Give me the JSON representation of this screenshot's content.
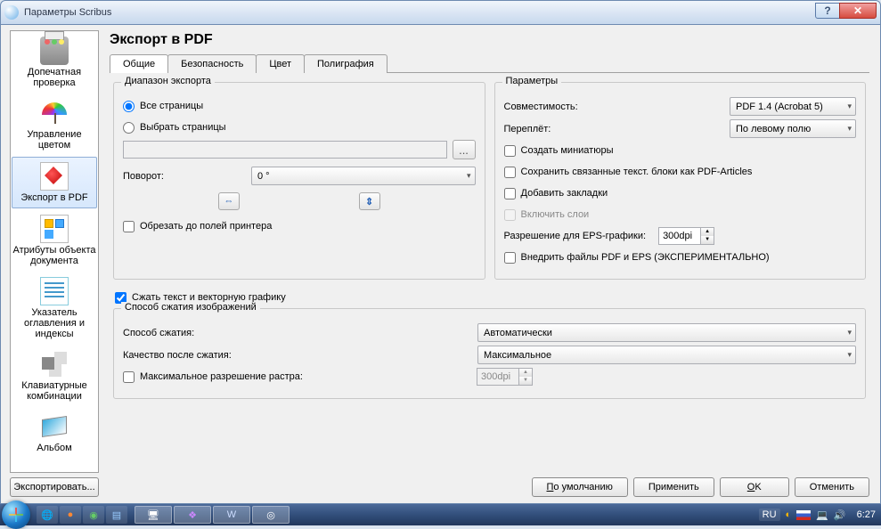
{
  "window": {
    "title": "Параметры Scribus",
    "help": "?",
    "close": "✕"
  },
  "sidebar": {
    "items": [
      {
        "label": "Допечатная проверка"
      },
      {
        "label": "Управление цветом"
      },
      {
        "label": "Экспорт в PDF"
      },
      {
        "label": "Атрибуты объекта документа"
      },
      {
        "label": "Указатель оглавления и индексы"
      },
      {
        "label": "Клавиатурные комбинации"
      },
      {
        "label": "Альбом"
      }
    ],
    "export_btn": "Экспортировать..."
  },
  "main": {
    "heading": "Экспорт в PDF",
    "tabs": [
      "Общие",
      "Безопасность",
      "Цвет",
      "Полиграфия"
    ],
    "range": {
      "legend": "Диапазон экспорта",
      "all_pages": "Все страницы",
      "select_pages": "Выбрать страницы",
      "browse": "...",
      "rotation_label": "Поворот:",
      "rotation_value": "0 °",
      "crop": "Обрезать до полей принтера"
    },
    "params": {
      "legend": "Параметры",
      "compat_label": "Совместимость:",
      "compat_value": "PDF 1.4 (Acrobat 5)",
      "binding_label": "Переплёт:",
      "binding_value": "По левому полю",
      "thumbnails": "Создать миниатюры",
      "articles": "Сохранить связанные текст. блоки как PDF-Articles",
      "bookmarks": "Добавить закладки",
      "layers": "Включить слои",
      "eps_res_label": "Разрешение для EPS-графики:",
      "eps_res_value": "300dpi",
      "embed": "Внедрить файлы PDF и EPS (ЭКСПЕРИМЕНТАЛЬНО)"
    },
    "compress_vector": "Сжать текст и векторную графику",
    "imgcomp": {
      "legend": "Способ сжатия изображений",
      "method_label": "Способ сжатия:",
      "method_value": "Автоматически",
      "quality_label": "Качество после сжатия:",
      "quality_value": "Максимальное",
      "maxres_label": "Максимальное разрешение растра:",
      "maxres_value": "300dpi"
    }
  },
  "buttons": {
    "defaults": "По умолчанию",
    "apply": "Применить",
    "ok": "OK",
    "cancel": "Отменить"
  },
  "taskbar": {
    "lang": "RU",
    "time": "6:27"
  }
}
